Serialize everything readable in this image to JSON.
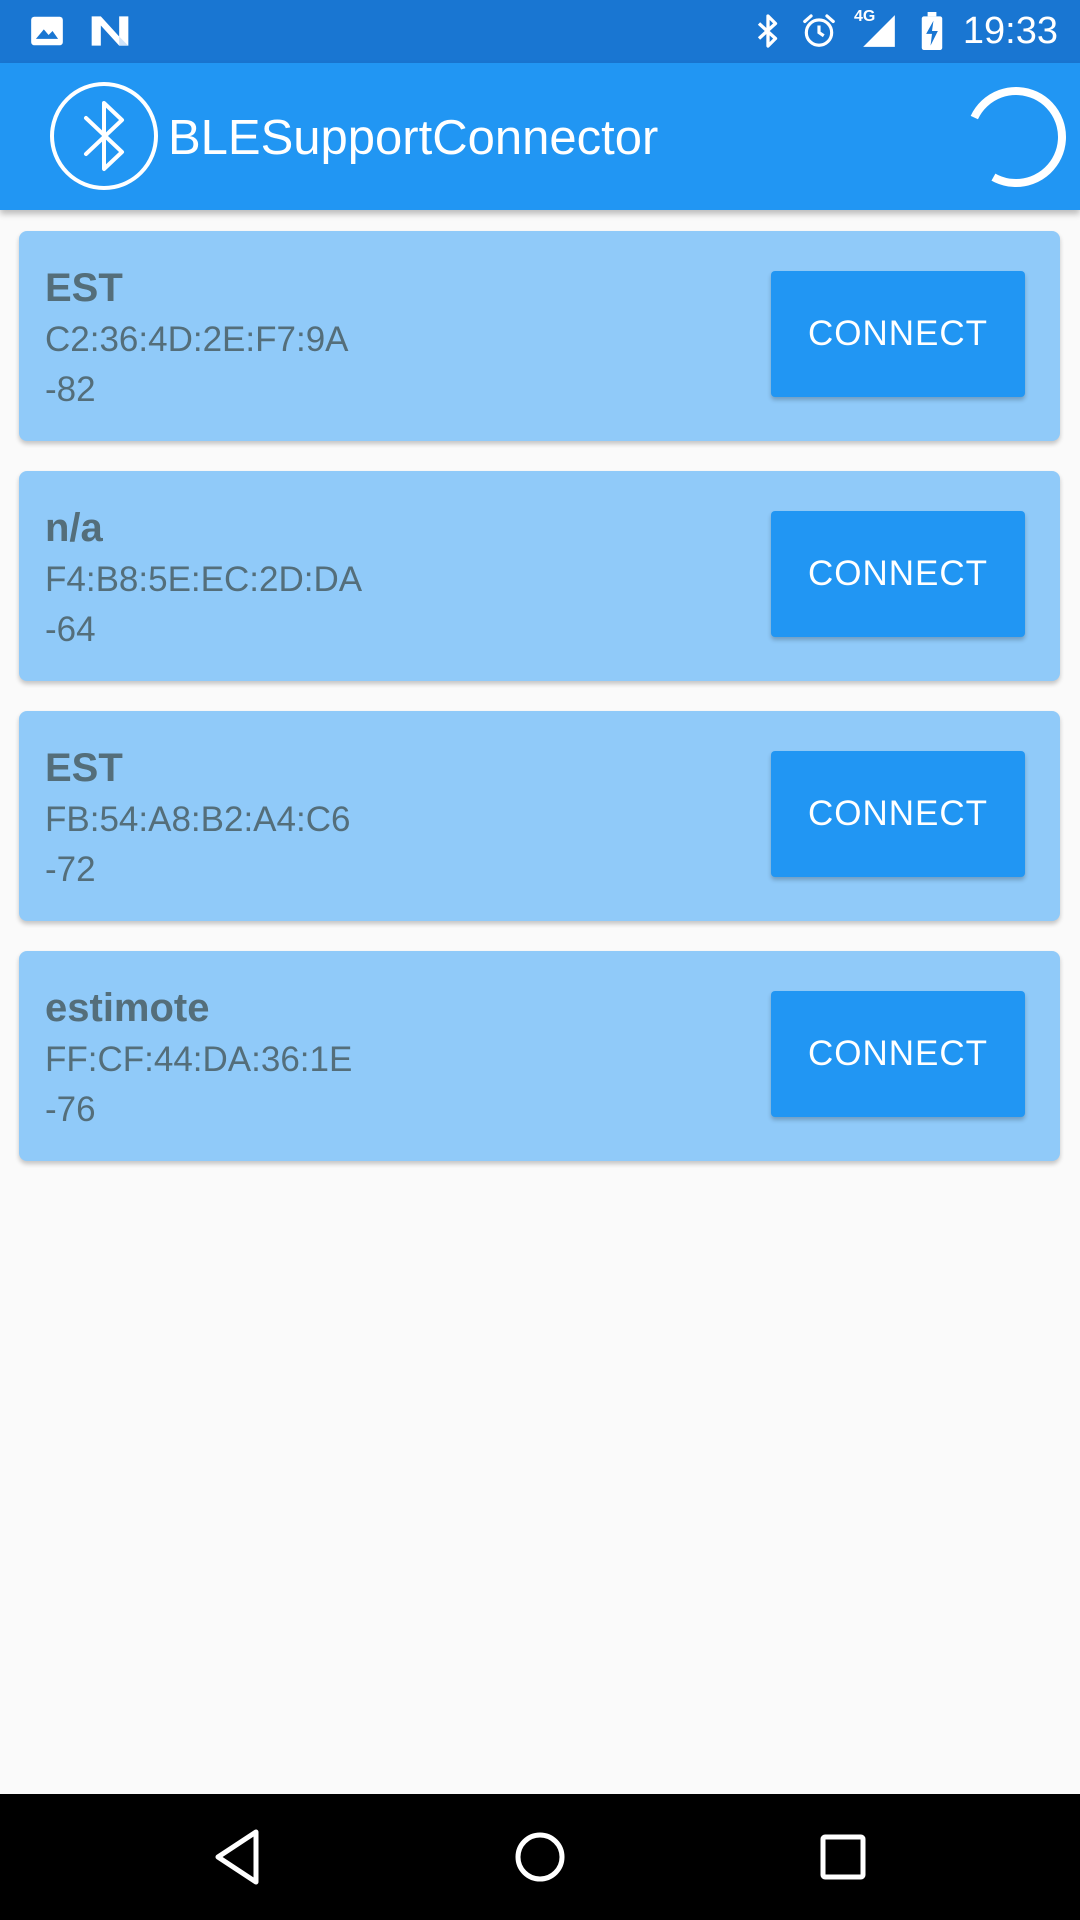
{
  "status_bar": {
    "time": "19:33",
    "network_type": "4G",
    "left_icons": [
      "image-icon",
      "n-notification-icon"
    ],
    "right_icons": [
      "bluetooth-icon",
      "alarm-icon",
      "signal-icon",
      "battery-charging-icon"
    ]
  },
  "app_bar": {
    "title": "BLESupportConnector",
    "logo_icon": "bluetooth-logo-icon",
    "scanning_indicator": "loading-spinner-icon"
  },
  "devices": [
    {
      "name": "EST",
      "mac": "C2:36:4D:2E:F7:9A",
      "rssi": "-82",
      "button_label": "CONNECT"
    },
    {
      "name": "n/a",
      "mac": "F4:B8:5E:EC:2D:DA",
      "rssi": "-64",
      "button_label": "CONNECT"
    },
    {
      "name": "EST",
      "mac": "FB:54:A8:B2:A4:C6",
      "rssi": "-72",
      "button_label": "CONNECT"
    },
    {
      "name": "estimote",
      "mac": "FF:CF:44:DA:36:1E",
      "rssi": "-76",
      "button_label": "CONNECT"
    }
  ],
  "nav_bar": {
    "buttons": [
      "back-icon",
      "home-icon",
      "recents-icon"
    ]
  },
  "colors": {
    "status_bar": "#1976d2",
    "app_bar": "#2196f3",
    "card": "#90caf9",
    "button": "#2196f3",
    "card_text": "#546e7a",
    "background": "#fafafa"
  }
}
